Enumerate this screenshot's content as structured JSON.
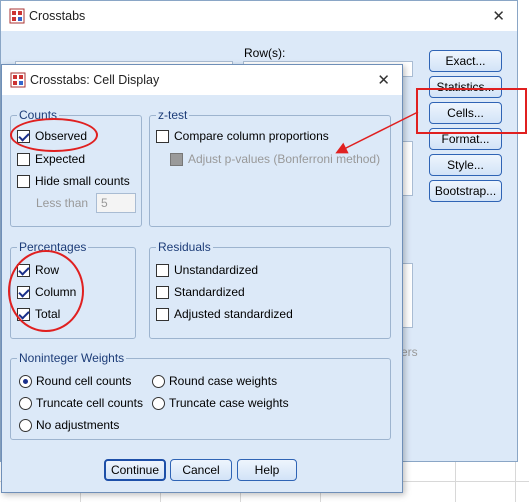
{
  "back_window": {
    "title": "Crosstabs",
    "rows_label": "Row(s):",
    "partial_text": "ers",
    "buttons": [
      "Exact...",
      "Statistics...",
      "Cells...",
      "Format...",
      "Style...",
      "Bootstrap..."
    ]
  },
  "dialog": {
    "title": "Crosstabs: Cell Display",
    "counts": {
      "legend": "Counts",
      "observed": {
        "label": "Observed",
        "checked": true
      },
      "expected": {
        "label": "Expected",
        "checked": false
      },
      "hide_small": {
        "label": "Hide small counts",
        "checked": false
      },
      "less_than_label": "Less than",
      "less_than_value": "5"
    },
    "ztest": {
      "legend": "z-test",
      "compare": {
        "label": "Compare column proportions",
        "checked": false
      },
      "adjust": {
        "label": "Adjust p-values (Bonferroni method)",
        "checked": false,
        "enabled": false
      }
    },
    "percentages": {
      "legend": "Percentages",
      "items": [
        {
          "label": "Row",
          "checked": true
        },
        {
          "label": "Column",
          "checked": true
        },
        {
          "label": "Total",
          "checked": true
        }
      ]
    },
    "residuals": {
      "legend": "Residuals",
      "items": [
        {
          "label": "Unstandardized",
          "checked": false
        },
        {
          "label": "Standardized",
          "checked": false
        },
        {
          "label": "Adjusted standardized",
          "checked": false
        }
      ]
    },
    "noninteger": {
      "legend": "Noninteger Weights",
      "round_cell": {
        "label": "Round cell counts",
        "selected": true
      },
      "round_case": {
        "label": "Round case weights",
        "selected": false
      },
      "truncate_cell": {
        "label": "Truncate cell counts",
        "selected": false
      },
      "truncate_case": {
        "label": "Truncate case weights",
        "selected": false
      },
      "no_adjust": {
        "label": "No adjustments",
        "selected": false
      }
    },
    "buttons": {
      "continue": "Continue",
      "cancel": "Cancel",
      "help": "Help"
    }
  },
  "colors": {
    "highlight": "#e02020",
    "dialog_bg": "#dce9f8",
    "button_border": "#2f64b5"
  }
}
